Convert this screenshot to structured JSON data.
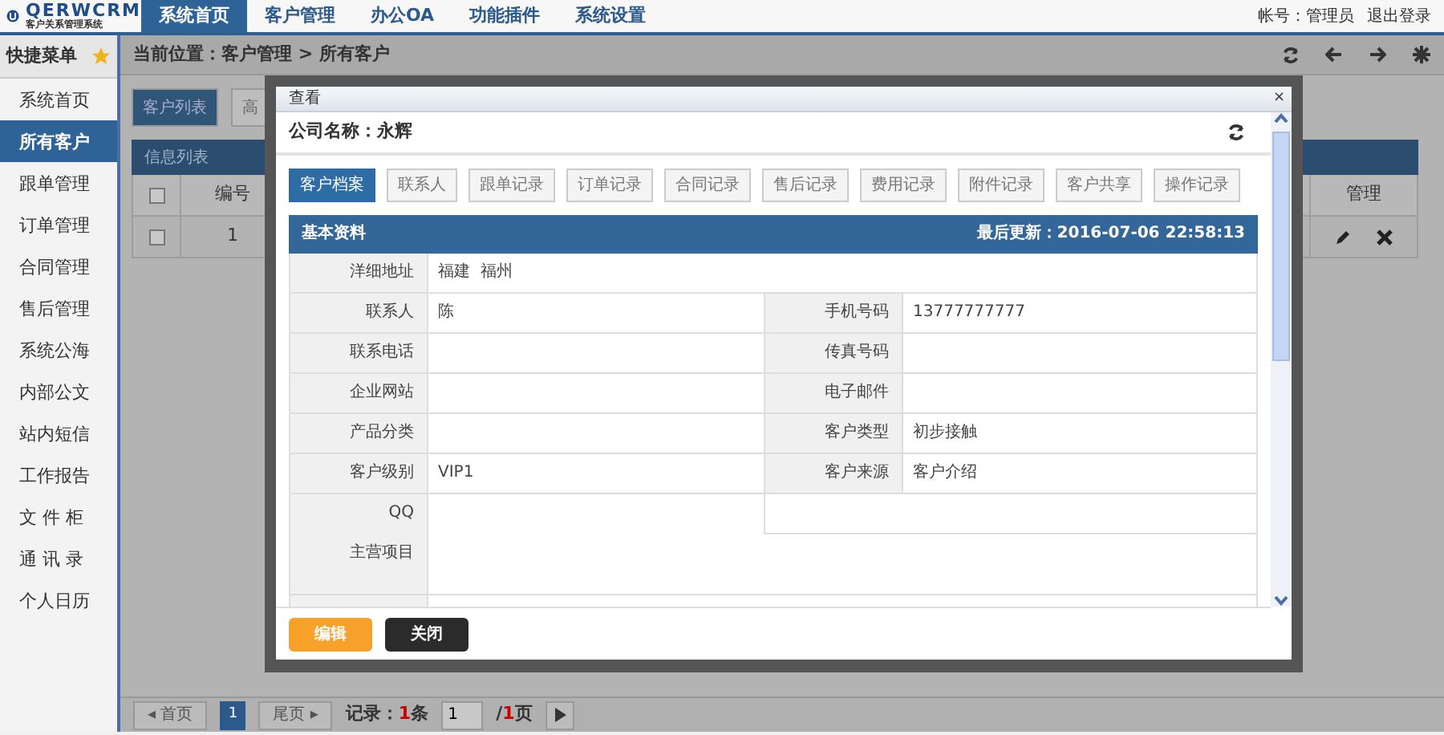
{
  "brand": {
    "name": "QERWCRM",
    "tagline": "客户关系管理系统"
  },
  "top_nav": [
    {
      "label": "系统首页",
      "selected": true
    },
    {
      "label": "客户管理",
      "selected": false
    },
    {
      "label": "办公OA",
      "selected": false
    },
    {
      "label": "功能插件",
      "selected": false
    },
    {
      "label": "系统设置",
      "selected": false
    }
  ],
  "account": {
    "label": "帐号：管理员",
    "logout": "退出登录"
  },
  "sidebar": {
    "title": "快捷菜单",
    "items": [
      {
        "label": "系统首页",
        "selected": false
      },
      {
        "label": "所有客户",
        "selected": true
      },
      {
        "label": "跟单管理",
        "selected": false
      },
      {
        "label": "订单管理",
        "selected": false
      },
      {
        "label": "合同管理",
        "selected": false
      },
      {
        "label": "售后管理",
        "selected": false
      },
      {
        "label": "系统公海",
        "selected": false
      },
      {
        "label": "内部公文",
        "selected": false
      },
      {
        "label": "站内短信",
        "selected": false
      },
      {
        "label": "工作报告",
        "selected": false
      },
      {
        "label": "文 件 柜",
        "selected": false
      },
      {
        "label": "通 讯 录",
        "selected": false
      },
      {
        "label": "个人日历",
        "selected": false
      }
    ]
  },
  "breadcrumb": "当前位置：客户管理 > 所有客户",
  "list_buttons": [
    {
      "label": "客户列表",
      "selected": true
    },
    {
      "label": "高",
      "selected": false
    }
  ],
  "list": {
    "title": "信息列表",
    "all_checked": false,
    "columns": [
      "编号",
      "管理"
    ],
    "rows": [
      {
        "number": "1",
        "checked": false
      }
    ]
  },
  "pagination": {
    "first": "◂ 首页",
    "current": "1",
    "last": "尾页 ▸",
    "records_label": "记录：",
    "records": "1",
    "records_unit": "条",
    "page_input": "1",
    "slash": "/",
    "pages": "1",
    "pages_unit": "页"
  },
  "dialog": {
    "title": "查看",
    "close": "×",
    "company": "公司名称：永辉",
    "tabs": [
      {
        "label": "客户档案",
        "selected": true
      },
      {
        "label": "联系人",
        "selected": false
      },
      {
        "label": "跟单记录",
        "selected": false
      },
      {
        "label": "订单记录",
        "selected": false
      },
      {
        "label": "合同记录",
        "selected": false
      },
      {
        "label": "售后记录",
        "selected": false
      },
      {
        "label": "费用记录",
        "selected": false
      },
      {
        "label": "附件记录",
        "selected": false
      },
      {
        "label": "客户共享",
        "selected": false
      },
      {
        "label": "操作记录",
        "selected": false
      }
    ],
    "section_title": "基本资料",
    "last_updated": "最后更新：2016-07-06 22:58:13",
    "rows": [
      {
        "kind": "full",
        "label": "洋细地址",
        "value": "福建  福州"
      },
      {
        "kind": "pair",
        "cells": [
          {
            "label": "联系人",
            "value": "陈"
          },
          {
            "label": "手机号码",
            "value": "13777777777"
          }
        ]
      },
      {
        "kind": "pair",
        "cells": [
          {
            "label": "联系电话"
          },
          {
            "label": "传真号码"
          }
        ]
      },
      {
        "kind": "pair",
        "cells": [
          {
            "label": "企业网站"
          },
          {
            "label": "电子邮件"
          }
        ]
      },
      {
        "kind": "pair",
        "cells": [
          {
            "label": "产品分类"
          },
          {
            "label": "客户类型",
            "value": "初步接触"
          }
        ]
      },
      {
        "kind": "pair",
        "cells": [
          {
            "label": "客户级别",
            "value": "VIP1"
          },
          {
            "label": "客户来源",
            "value": "客户介绍"
          }
        ]
      },
      {
        "kind": "half",
        "label": "QQ"
      },
      {
        "kind": "tall",
        "label": "主营项目"
      },
      {
        "kind": "cut"
      }
    ],
    "buttons": [
      {
        "label": "编辑",
        "kind": "primary"
      },
      {
        "label": "关闭",
        "kind": "dark"
      }
    ]
  }
}
